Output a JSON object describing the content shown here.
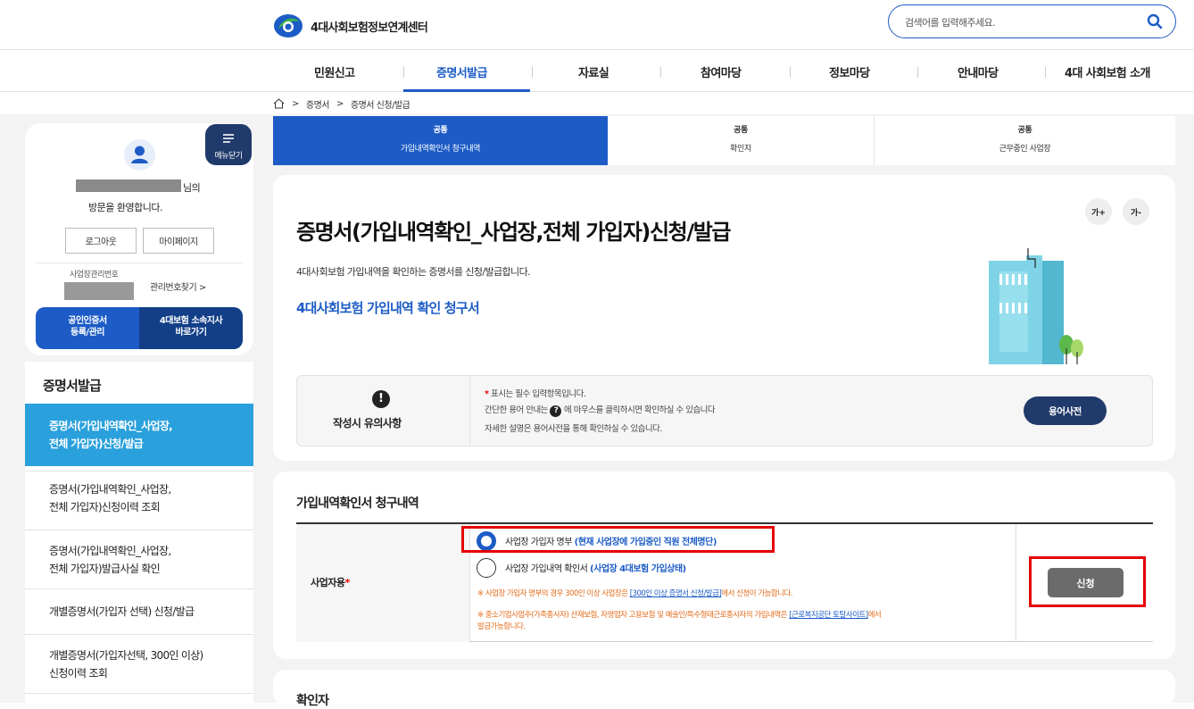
{
  "header": {
    "logo_text": "4대사회보험정보연계센터",
    "search_placeholder": "검색어를 입력해주세요."
  },
  "nav": {
    "items": [
      "민원신고",
      "증명서발급",
      "자료실",
      "참여마당",
      "정보마당",
      "안내마당",
      "4대 사회보험 소개"
    ],
    "active": "증명서발급"
  },
  "breadcrumb": [
    "증명서",
    "증명서 신청/발급"
  ],
  "sidebar": {
    "menu_close": "메뉴닫기",
    "greeting_suffix": "님의",
    "greeting": "방문을 환영합니다.",
    "logout": "로그아웃",
    "mypage": "마이페이지",
    "biz_number_label": "사업장관리번호",
    "find_number": "관리번호찾기 >",
    "cert_button": [
      "공인인증서",
      "등록/관리"
    ],
    "branch_button": [
      "4대보험 소속지사",
      "바로가기"
    ],
    "section_title": "증명서발급",
    "items": [
      [
        "증명서(가입내역확인_사업장,",
        "전체 가입자)신청/발급"
      ],
      [
        "증명서(가입내역확인_사업장,",
        "전체 가입자)신청이력 조회"
      ],
      [
        "증명서(가입내역확인_사업장,",
        "전체 가입자)발급사실 확인"
      ],
      [
        "개별증명서(가입자 선택) 신청/발급"
      ],
      [
        "개별증명서(가입자선택, 300인 이상)",
        "신청이력 조회"
      ]
    ]
  },
  "tabs": [
    {
      "top": "공통",
      "bottom": "가입내역확인서 청구내역"
    },
    {
      "top": "공통",
      "bottom": "확인지"
    },
    {
      "top": "공통",
      "bottom": "근무중인 사업장"
    }
  ],
  "main": {
    "title": "증명서(가입내역확인_사업장,전체 가입자)신청/발급",
    "subtitle": "4대사회보험 가입내역을 확인하는 증명서를 신청/발급합니다.",
    "form_link": "4대사회보험 가입내역 확인 청구서",
    "font_up": "가+",
    "font_down": "가-",
    "notice": {
      "label": "작성시 유의사항",
      "line1_star": "*",
      "line1": " 표시는 필수 입력항목입니다.",
      "line2a": "간단한 용어 안내는 ",
      "line2b": " 에 마우스를 클릭하시면 확인하실 수 있습니다",
      "line3": "자세한 설명은 용어사전을 통해 확인하실 수 있습니다.",
      "dict_button": "용어사전"
    },
    "section_title": "가입내역확인서 청구내역",
    "row_label": "사업자용",
    "row_label_star": "*",
    "option1": "사업장 가입자 명부 ",
    "option1_note": "(현재 사업장에 가입중인 직원 전체명단)",
    "option2": "사업장 가입내역 확인서 ",
    "option2_note": "(사업장 4대보험 가입상태)",
    "warn1a": "※ 사업장 가입자 명부의 경우 300인 이상 사업장은 ",
    "warn1_link": "[300인 이상 증명서 신청/발급]",
    "warn1b": "에서 신청이 가능합니다.",
    "warn2a": "※ 중소기업사업주(가족종사자) 산재보험, 자영업자 고용보험 및 예술인/특수형태근로종사자의 가입내역은 ",
    "warn2_link": "[근로복지공단 토탈사이트]",
    "warn2b": "에서",
    "warn2c": "발급가능합니다.",
    "apply_button": "신청",
    "next_section": "확인자"
  }
}
